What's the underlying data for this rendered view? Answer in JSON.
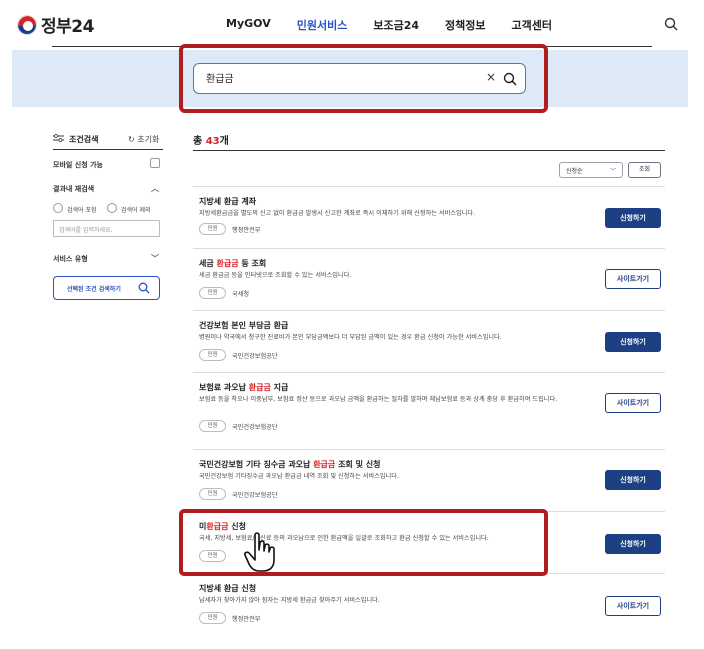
{
  "header": {
    "logo_text": "정부24",
    "nav": [
      "MyGOV",
      "민원서비스",
      "보조금24",
      "정책정보",
      "고객센터"
    ],
    "active_nav": "민원서비스"
  },
  "search": {
    "value": "환급금",
    "clear_glyph": "×"
  },
  "sidebar": {
    "title": "조건검색",
    "reset": "초기화",
    "mobile_label": "모바일 신청 가능",
    "within_label": "결과내 재검색",
    "include_label": "검색어 포함",
    "exclude_label": "검색어 제외",
    "input_placeholder": "검색어를 입력하세요.",
    "service_type_label": "서비스 유형",
    "search_button": "선택된 조건 검색하기"
  },
  "results": {
    "total_prefix": "총 ",
    "total_count": "43",
    "total_suffix": "개",
    "sort_value": "신청순",
    "search_button": "조회"
  },
  "items": [
    {
      "title_parts": [
        "지방세 환급 계좌",
        "",
        ""
      ],
      "desc": "지방세환급금을 별도의 신고 없이 환급금 발생시 신고한 계좌로 즉시 이체하기 위해 신청하는 서비스입니다.",
      "tag": "민원",
      "org": "행정안전부",
      "button": "신청하기",
      "button_type": "apply"
    },
    {
      "title_parts": [
        "세금 ",
        "환급금",
        " 등 조회"
      ],
      "desc": "세금 환급금 등을 인터넷으로 조회할 수 있는 서비스입니다.",
      "tag": "민원",
      "org": "국세청",
      "button": "사이트가기",
      "button_type": "site"
    },
    {
      "title_parts": [
        "건강보험 본인 부담금 환급",
        "",
        ""
      ],
      "desc": "병원이나 약국에서 청구한 진료비가 본인 부담금액보다 더 부담된 금액이 있는 경우 환급 신청이 가능한 서비스입니다.",
      "tag": "민원",
      "org": "국민건강보험공단",
      "button": "신청하기",
      "button_type": "apply"
    },
    {
      "title_parts": [
        "보험료 과오납 ",
        "환급금",
        " 지급"
      ],
      "desc": "보험료 등을 착오나 이중납부, 보험료 정산 등으로 과오납 금액을 환급하는 절차를 말하며 체납보험료 등과 상계 충당 후 환급하여 드립니다.",
      "tag": "민원",
      "org": "국민건강보험공단",
      "button": "사이트가기",
      "button_type": "site"
    },
    {
      "title_parts": [
        "국민건강보험 기타 징수금 과오납 ",
        "환급금",
        " 조회 및 신청"
      ],
      "desc": "국민건강보험 기타징수금 과오납 환급금 내역 조회 및 신청하는 서비스입니다.",
      "tag": "민원",
      "org": "국민건강보험공단",
      "button": "신청하기",
      "button_type": "apply"
    },
    {
      "title_parts": [
        "미",
        "환급금",
        " 신청"
      ],
      "desc": "국세, 지방세, 보험료/통신료 등의 과오납으로 인한 환급액을 일괄로 조회하고 환급 신청할 수 있는 서비스입니다.",
      "tag": "민원",
      "org": "",
      "button": "신청하기",
      "button_type": "apply"
    },
    {
      "title_parts": [
        "지방세 환급 신청",
        "",
        ""
      ],
      "desc": "납세자가 찾아가지 않아 잠자는 지방세 환급금 찾아주기 서비스입니다.",
      "tag": "민원",
      "org": "행정안전부",
      "button": "사이트가기",
      "button_type": "site"
    }
  ],
  "colors": {
    "accent": "#2852c6",
    "highlight": "#d8232a",
    "annotation": "#b01d1f",
    "primary_button": "#1d3f84",
    "search_band": "#dde9f7"
  }
}
